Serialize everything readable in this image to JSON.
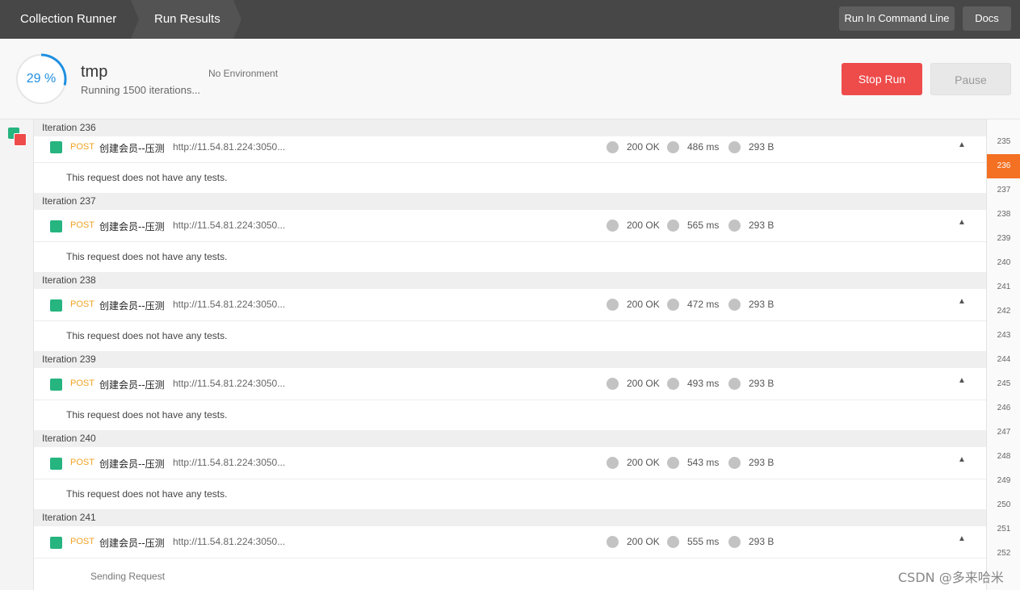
{
  "topbar": {
    "breadcrumbs": [
      "Collection Runner",
      "Run Results"
    ],
    "run_command_line_label": "Run In Command Line",
    "docs_label": "Docs"
  },
  "run": {
    "progress_percent": 29,
    "progress_label": "29 %",
    "name": "tmp",
    "status": "Running 1500 iterations...",
    "environment": "No Environment",
    "stop_label": "Stop Run",
    "pause_label": "Pause"
  },
  "colors": {
    "accent_blue": "#1f8fe0",
    "stop_red": "#ee4b4b",
    "pass_green": "#26b47f",
    "method_orange": "#f0a323",
    "active_index": "#f47023"
  },
  "iterations": [
    {
      "label": "Iteration 236",
      "method": "POST",
      "name": "创建会员--压测",
      "url": "http://11.54.81.224:3050...",
      "status": "200 OK",
      "time": "486 ms",
      "size": "293 B",
      "tests": "This request does not have any tests."
    },
    {
      "label": "Iteration 237",
      "method": "POST",
      "name": "创建会员--压测",
      "url": "http://11.54.81.224:3050...",
      "status": "200 OK",
      "time": "565 ms",
      "size": "293 B",
      "tests": "This request does not have any tests."
    },
    {
      "label": "Iteration 238",
      "method": "POST",
      "name": "创建会员--压测",
      "url": "http://11.54.81.224:3050...",
      "status": "200 OK",
      "time": "472 ms",
      "size": "293 B",
      "tests": "This request does not have any tests."
    },
    {
      "label": "Iteration 239",
      "method": "POST",
      "name": "创建会员--压测",
      "url": "http://11.54.81.224:3050...",
      "status": "200 OK",
      "time": "493 ms",
      "size": "293 B",
      "tests": "This request does not have any tests."
    },
    {
      "label": "Iteration 240",
      "method": "POST",
      "name": "创建会员--压测",
      "url": "http://11.54.81.224:3050...",
      "status": "200 OK",
      "time": "543 ms",
      "size": "293 B",
      "tests": "This request does not have any tests."
    },
    {
      "label": "Iteration 241",
      "method": "POST",
      "name": "创建会员--压测",
      "url": "http://11.54.81.224:3050...",
      "status": "200 OK",
      "time": "555 ms",
      "size": "293 B",
      "tests": ""
    }
  ],
  "sending_text": "Sending Request",
  "index_numbers": [
    "235",
    "236",
    "237",
    "238",
    "239",
    "240",
    "241",
    "242",
    "243",
    "244",
    "245",
    "246",
    "247",
    "248",
    "249",
    "250",
    "251",
    "252"
  ],
  "active_index": "236",
  "watermark": "CSDN @多来哈米"
}
